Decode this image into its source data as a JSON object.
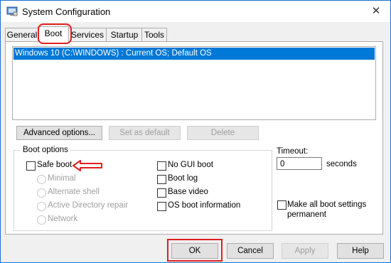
{
  "window": {
    "title": "System Configuration",
    "close_glyph": "✕"
  },
  "tabs": [
    {
      "label": "General"
    },
    {
      "label": "Boot"
    },
    {
      "label": "Services"
    },
    {
      "label": "Startup"
    },
    {
      "label": "Tools"
    }
  ],
  "os_list": {
    "selected": "Windows 10 (C:\\WINDOWS) : Current OS; Default OS"
  },
  "buttons": {
    "advanced": "Advanced options...",
    "set_default": "Set as default",
    "delete": "Delete"
  },
  "boot_options": {
    "group_label": "Boot options",
    "safe_boot": "Safe boot",
    "minimal": "Minimal",
    "alternate_shell": "Alternate shell",
    "ad_repair": "Active Directory repair",
    "network": "Network",
    "no_gui": "No GUI boot",
    "boot_log": "Boot log",
    "base_video": "Base video",
    "os_boot_info": "OS boot information"
  },
  "timeout": {
    "label": "Timeout:",
    "value": "0",
    "unit": "seconds"
  },
  "permanent": {
    "label": "Make all boot settings permanent"
  },
  "footer": {
    "ok": "OK",
    "cancel": "Cancel",
    "apply": "Apply",
    "help": "Help"
  },
  "colors": {
    "highlight_red": "#e02020",
    "selection_blue": "#0078d7"
  }
}
